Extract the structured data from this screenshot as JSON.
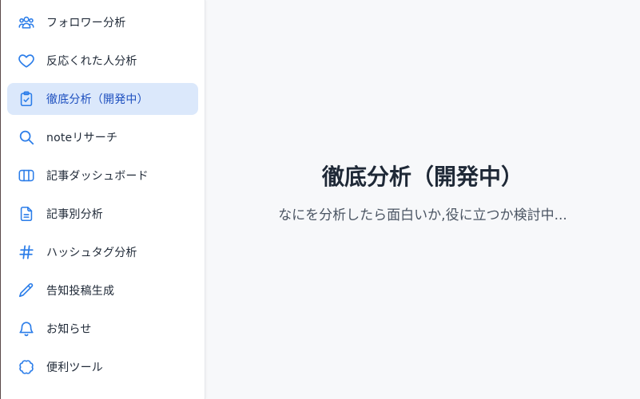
{
  "sidebar": {
    "items": [
      {
        "label": "フォロワー分析",
        "icon": "users-icon",
        "active": false
      },
      {
        "label": "反応くれた人分析",
        "icon": "heart-icon",
        "active": false
      },
      {
        "label": "徹底分析（開発中）",
        "icon": "clipboard-check-icon",
        "active": true
      },
      {
        "label": "noteリサーチ",
        "icon": "search-icon",
        "active": false
      },
      {
        "label": "記事ダッシュボード",
        "icon": "columns-icon",
        "active": false
      },
      {
        "label": "記事別分析",
        "icon": "document-icon",
        "active": false
      },
      {
        "label": "ハッシュタグ分析",
        "icon": "hashtag-icon",
        "active": false
      },
      {
        "label": "告知投稿生成",
        "icon": "pencil-icon",
        "active": false
      },
      {
        "label": "お知らせ",
        "icon": "bell-icon",
        "active": false
      },
      {
        "label": "便利ツール",
        "icon": "badge-icon",
        "active": false
      }
    ]
  },
  "main": {
    "title": "徹底分析（開発中）",
    "subtitle": "なにを分析したら面白いか,役に立つか検討中..."
  },
  "colors": {
    "accent": "#2b7de9",
    "active_bg": "#dbe8fb",
    "active_text": "#1d4fbf",
    "main_bg": "#f7f8fa"
  }
}
